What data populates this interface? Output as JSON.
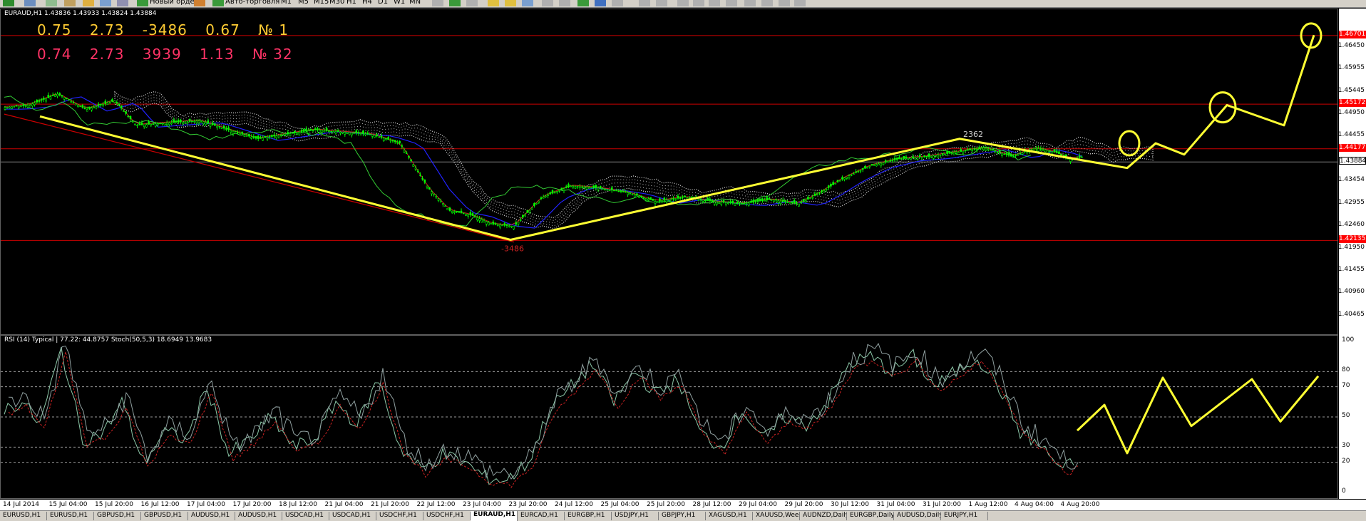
{
  "toolbar": {
    "new_order_label": "Новый ордер",
    "auto_trading_label": "Авто-торговля",
    "timeframes": [
      "M1",
      "M5",
      "M15",
      "M30",
      "H1",
      "H4",
      "D1",
      "W1",
      "MN"
    ]
  },
  "chart": {
    "header": "EURAUD,H1  1.43836 1.43933 1.43824 1.43884",
    "stats_line1": [
      "0.75",
      "2.73",
      "-3486",
      "0.67",
      "№ 1"
    ],
    "stats_line2": [
      "0.74",
      "2.73",
      "3939",
      "1.13",
      "№ 32"
    ],
    "label_low": "-3486",
    "label_high": "2362",
    "price_ticks": [
      "1.46450",
      "1.45955",
      "1.45445",
      "1.44950",
      "1.44455",
      "1.43454",
      "1.42955",
      "1.42460",
      "1.41950",
      "1.41455",
      "1.40960",
      "1.40465"
    ],
    "price_tags": [
      "1.46701",
      "1.45172",
      "1.44177",
      "1.43884",
      "1.42135"
    ],
    "colors": {
      "background": "#000000",
      "candles": "#00ff00",
      "forecast": "#ffff33",
      "hlines": "#cc0000",
      "tag": "#ff0000",
      "stats1": "#ffcc33",
      "stats2": "#ff3366"
    }
  },
  "rsi": {
    "header": "RSI (14) Typical | 77.22: 44.8757   Stoch(50,5,3) 18.6949 13.9683",
    "ticks": [
      "100",
      "80",
      "70",
      "50",
      "30",
      "20",
      "0"
    ]
  },
  "time_axis": [
    "14 Jul 2014",
    "15 Jul 04:00",
    "15 Jul 20:00",
    "16 Jul 12:00",
    "17 Jul 04:00",
    "17 Jul 20:00",
    "18 Jul 12:00",
    "21 Jul 04:00",
    "21 Jul 20:00",
    "22 Jul 12:00",
    "23 Jul 04:00",
    "23 Jul 20:00",
    "24 Jul 12:00",
    "25 Jul 04:00",
    "25 Jul 20:00",
    "28 Jul 12:00",
    "29 Jul 04:00",
    "29 Jul 20:00",
    "30 Jul 12:00",
    "31 Jul 04:00",
    "31 Jul 20:00",
    "1 Aug 12:00",
    "4 Aug 04:00",
    "4 Aug 20:00"
  ],
  "tabs": [
    "EURUSD,H1",
    "EURUSD,H1",
    "GBPUSD,H1",
    "GBPUSD,H1",
    "AUDUSD,H1",
    "AUDUSD,H1",
    "USDCAD,H1",
    "USDCAD,H1",
    "USDCHF,H1",
    "USDCHF,H1",
    "EURAUD,H1",
    "EURCAD,H1",
    "EURGBP,H1",
    "USDJPY,H1",
    "GBPJPY,H1",
    "XAGUSD,H1",
    "XAUUSD,Weekly",
    "AUDNZD,Daily",
    "EURGBP,Daily",
    "AUDUSD,Daily",
    "EURJPY,H1"
  ],
  "active_tab_index": 10
}
